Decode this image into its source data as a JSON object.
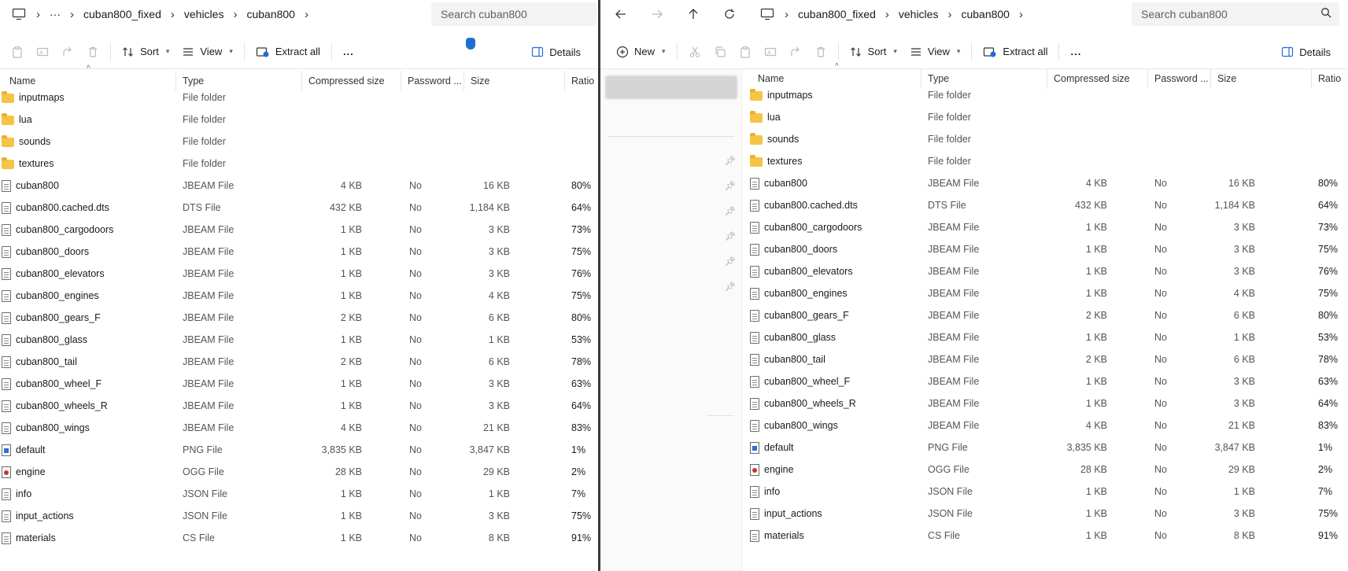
{
  "left": {
    "breadcrumb": [
      "cuban800_fixed",
      "vehicles",
      "cuban800"
    ],
    "search_placeholder": "Search cuban800",
    "toolbar": {
      "sort": "Sort",
      "view": "View",
      "extract": "Extract all",
      "more": "...",
      "details": "Details"
    },
    "columns": {
      "name": "Name",
      "type": "Type",
      "compressed": "Compressed size",
      "password": "Password ...",
      "size": "Size",
      "ratio": "Ratio"
    }
  },
  "right": {
    "breadcrumb": [
      "cuban800_fixed",
      "vehicles",
      "cuban800"
    ],
    "search_placeholder": "Search cuban800",
    "toolbar": {
      "new": "New",
      "sort": "Sort",
      "view": "View",
      "extract": "Extract all",
      "more": "...",
      "details": "Details"
    },
    "columns": {
      "name": "Name",
      "type": "Type",
      "compressed": "Compressed size",
      "password": "Password ...",
      "size": "Size",
      "ratio": "Ratio"
    }
  },
  "files": [
    {
      "name": "inputmaps",
      "type": "File folder",
      "compressed": "",
      "password": "",
      "size": "",
      "ratio": "",
      "icon": "folder"
    },
    {
      "name": "lua",
      "type": "File folder",
      "compressed": "",
      "password": "",
      "size": "",
      "ratio": "",
      "icon": "folder"
    },
    {
      "name": "sounds",
      "type": "File folder",
      "compressed": "",
      "password": "",
      "size": "",
      "ratio": "",
      "icon": "folder"
    },
    {
      "name": "textures",
      "type": "File folder",
      "compressed": "",
      "password": "",
      "size": "",
      "ratio": "",
      "icon": "folder"
    },
    {
      "name": "cuban800",
      "type": "JBEAM File",
      "compressed": "4 KB",
      "password": "No",
      "size": "16 KB",
      "ratio": "80%",
      "icon": "doc"
    },
    {
      "name": "cuban800.cached.dts",
      "type": "DTS File",
      "compressed": "432 KB",
      "password": "No",
      "size": "1,184 KB",
      "ratio": "64%",
      "icon": "doc"
    },
    {
      "name": "cuban800_cargodoors",
      "type": "JBEAM File",
      "compressed": "1 KB",
      "password": "No",
      "size": "3 KB",
      "ratio": "73%",
      "icon": "doc"
    },
    {
      "name": "cuban800_doors",
      "type": "JBEAM File",
      "compressed": "1 KB",
      "password": "No",
      "size": "3 KB",
      "ratio": "75%",
      "icon": "doc"
    },
    {
      "name": "cuban800_elevators",
      "type": "JBEAM File",
      "compressed": "1 KB",
      "password": "No",
      "size": "3 KB",
      "ratio": "76%",
      "icon": "doc"
    },
    {
      "name": "cuban800_engines",
      "type": "JBEAM File",
      "compressed": "1 KB",
      "password": "No",
      "size": "4 KB",
      "ratio": "75%",
      "icon": "doc"
    },
    {
      "name": "cuban800_gears_F",
      "type": "JBEAM File",
      "compressed": "2 KB",
      "password": "No",
      "size": "6 KB",
      "ratio": "80%",
      "icon": "doc"
    },
    {
      "name": "cuban800_glass",
      "type": "JBEAM File",
      "compressed": "1 KB",
      "password": "No",
      "size": "1 KB",
      "ratio": "53%",
      "icon": "doc"
    },
    {
      "name": "cuban800_tail",
      "type": "JBEAM File",
      "compressed": "2 KB",
      "password": "No",
      "size": "6 KB",
      "ratio": "78%",
      "icon": "doc"
    },
    {
      "name": "cuban800_wheel_F",
      "type": "JBEAM File",
      "compressed": "1 KB",
      "password": "No",
      "size": "3 KB",
      "ratio": "63%",
      "icon": "doc"
    },
    {
      "name": "cuban800_wheels_R",
      "type": "JBEAM File",
      "compressed": "1 KB",
      "password": "No",
      "size": "3 KB",
      "ratio": "64%",
      "icon": "doc"
    },
    {
      "name": "cuban800_wings",
      "type": "JBEAM File",
      "compressed": "4 KB",
      "password": "No",
      "size": "21 KB",
      "ratio": "83%",
      "icon": "doc"
    },
    {
      "name": "default",
      "type": "PNG File",
      "compressed": "3,835 KB",
      "password": "No",
      "size": "3,847 KB",
      "ratio": "1%",
      "icon": "png"
    },
    {
      "name": "engine",
      "type": "OGG File",
      "compressed": "28 KB",
      "password": "No",
      "size": "29 KB",
      "ratio": "2%",
      "icon": "ogg"
    },
    {
      "name": "info",
      "type": "JSON File",
      "compressed": "1 KB",
      "password": "No",
      "size": "1 KB",
      "ratio": "7%",
      "icon": "doc"
    },
    {
      "name": "input_actions",
      "type": "JSON File",
      "compressed": "1 KB",
      "password": "No",
      "size": "3 KB",
      "ratio": "75%",
      "icon": "doc"
    },
    {
      "name": "materials",
      "type": "CS File",
      "compressed": "1 KB",
      "password": "No",
      "size": "8 KB",
      "ratio": "91%",
      "icon": "doc"
    }
  ]
}
